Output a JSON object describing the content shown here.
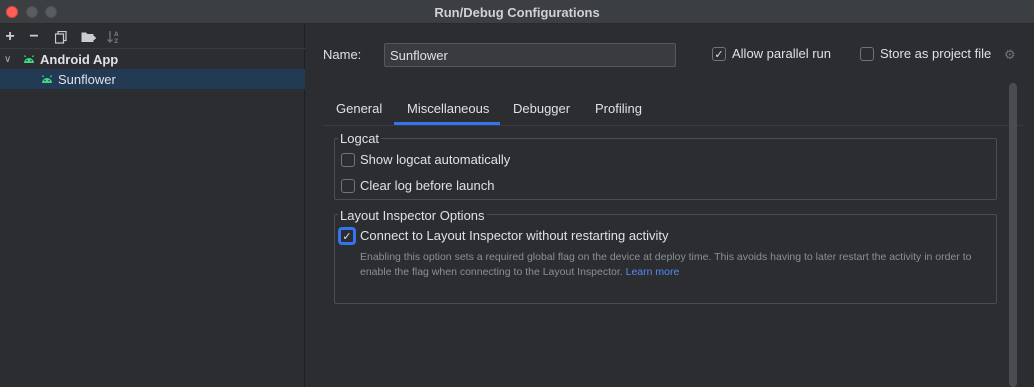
{
  "window": {
    "title": "Run/Debug Configurations"
  },
  "toolbar": {
    "icons": [
      "plus-icon",
      "minus-icon",
      "copy-icon",
      "folder-plus-icon",
      "sort-icon"
    ]
  },
  "tree": {
    "group_label": "Android App",
    "item_label": "Sunflower"
  },
  "form": {
    "name_label": "Name:",
    "name_value": "Sunflower",
    "allow_parallel_label": "Allow parallel run",
    "allow_parallel_checked": true,
    "store_project_label": "Store as project file",
    "store_project_checked": false
  },
  "tabs": [
    {
      "label": "General"
    },
    {
      "label": "Miscellaneous",
      "active": true
    },
    {
      "label": "Debugger"
    },
    {
      "label": "Profiling"
    }
  ],
  "logcat": {
    "title": "Logcat",
    "show_logcat_label": "Show logcat automatically",
    "show_logcat_checked": false,
    "clear_log_label": "Clear log before launch",
    "clear_log_checked": false
  },
  "layout_inspector": {
    "title": "Layout Inspector Options",
    "connect_label": "Connect to Layout Inspector without restarting activity",
    "connect_checked": true,
    "help_text": "Enabling this option sets a required global flag on the device at deploy time. This avoids having to later restart the activity in order to enable the flag when connecting to the Layout Inspector.",
    "learn_more": "Learn more"
  },
  "colors": {
    "accent": "#3574f0",
    "android_green": "#3ddc84",
    "link": "#548af7"
  }
}
